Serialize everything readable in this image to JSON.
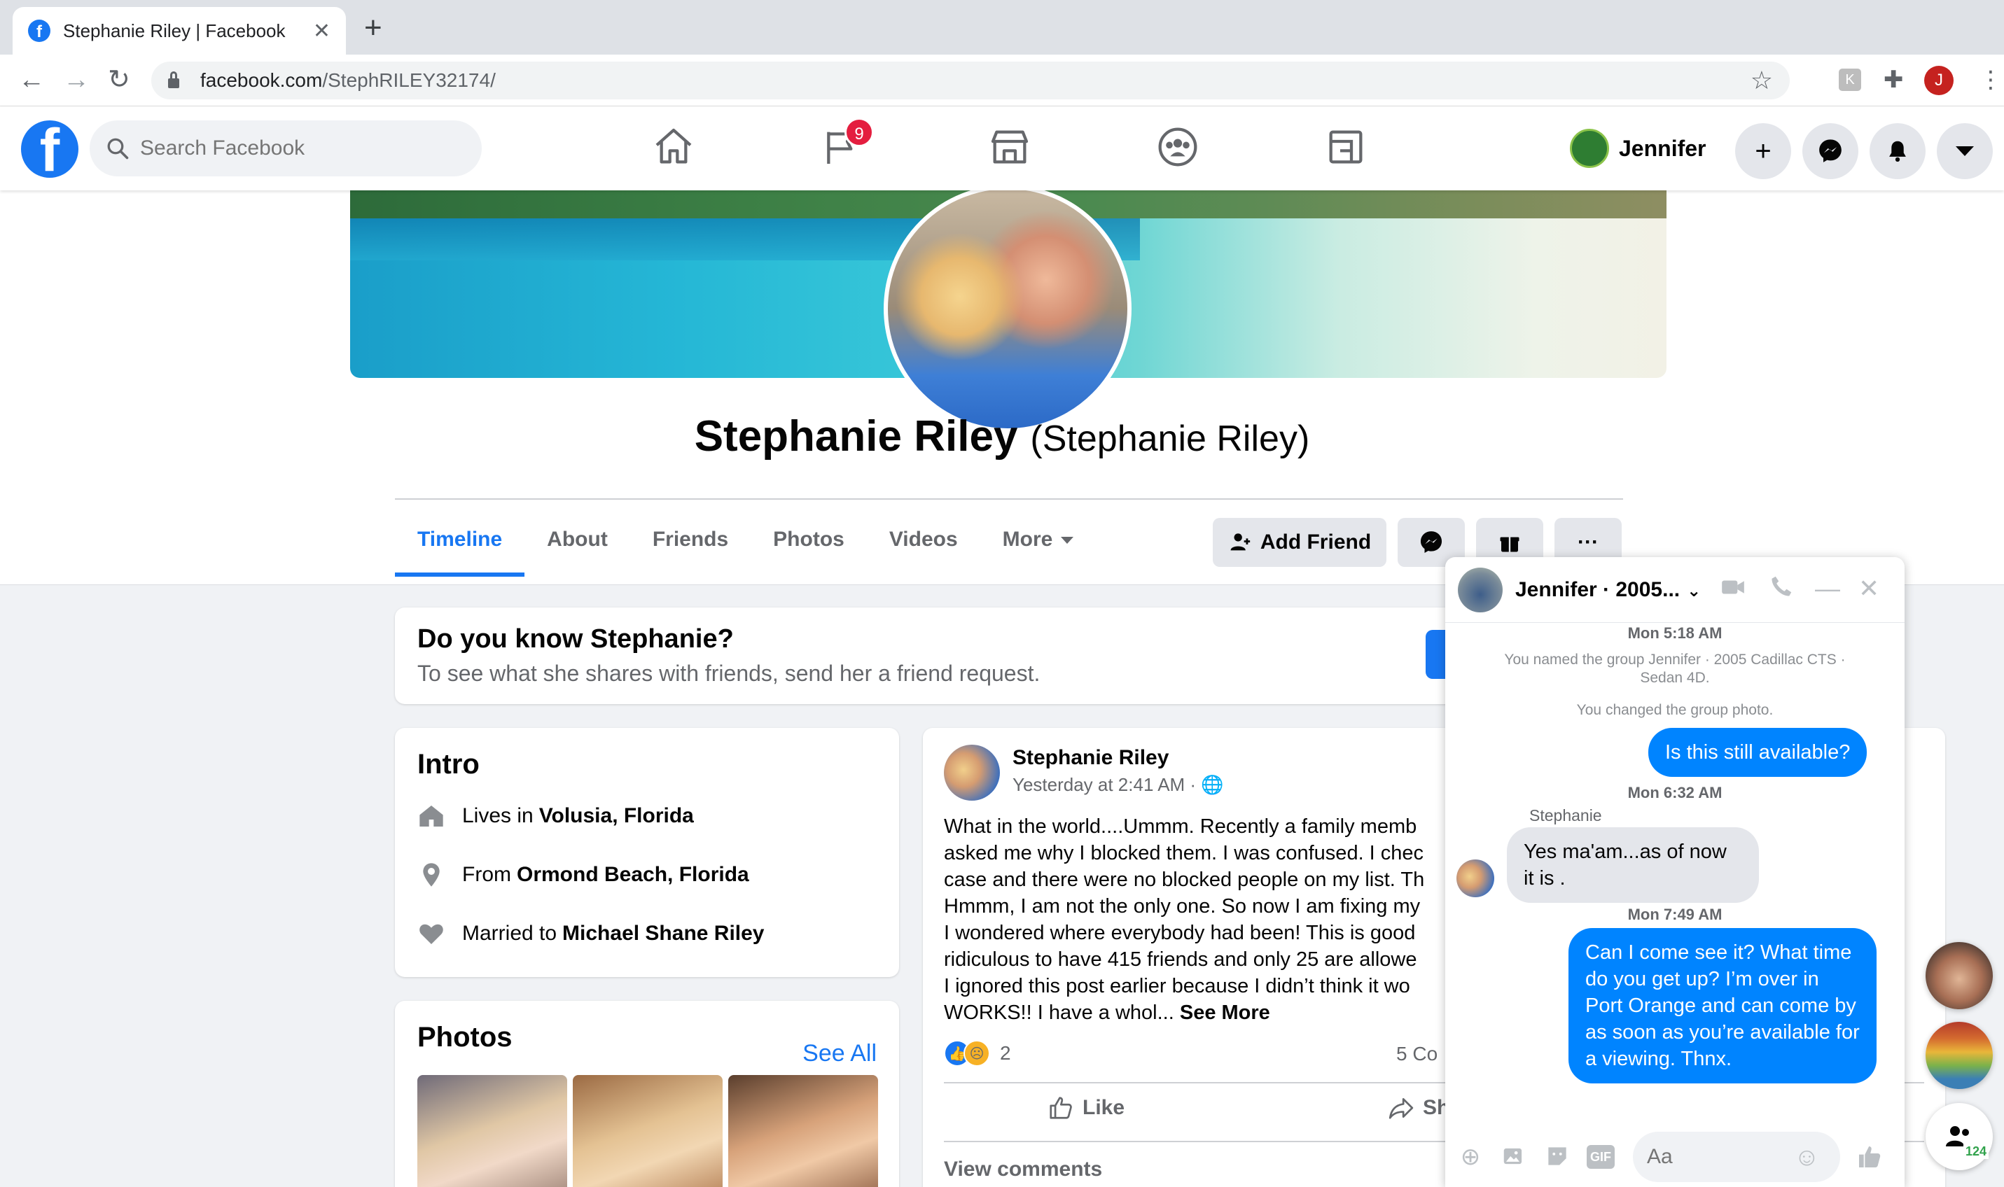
{
  "browser": {
    "tab_title": "Stephanie Riley | Facebook",
    "url_domain": "facebook.com",
    "url_path": "/StephRILEY32174/",
    "profile_initial": "J"
  },
  "fb": {
    "search_placeholder": "Search Facebook",
    "pages_badge": "9",
    "user_name": "Jennifer"
  },
  "profile": {
    "name": "Stephanie Riley",
    "alt_name": "(Stephanie Riley)",
    "tabs": [
      "Timeline",
      "About",
      "Friends",
      "Photos",
      "Videos",
      "More"
    ],
    "active_tab": "Timeline",
    "add_friend_label": "Add Friend"
  },
  "know": {
    "title": "Do you know Stephanie?",
    "subtitle": "To see what she shares with friends, send her a friend request."
  },
  "intro": {
    "title": "Intro",
    "lives_prefix": "Lives in",
    "lives": "Volusia, Florida",
    "from_prefix": "From",
    "from": "Ormond Beach, Florida",
    "married_prefix": "Married to",
    "married": "Michael Shane Riley"
  },
  "photos": {
    "title": "Photos",
    "see_all": "See All"
  },
  "post": {
    "author": "Stephanie Riley",
    "time": "Yesterday at 2:41 AM ·",
    "text": "What in the world....Ummm. Recently a family memb\nasked me why I blocked them. I was confused. I chec\ncase and there were no blocked people on my list. Th\nHmmm, I am not the only one. So now I am fixing my\nI wondered where everybody had been! This is good\nridiculous to have 415 friends and only 25 are allowe\nI ignored this post earlier because I didn’t think it wo\nWORKS!! I have a whol...",
    "see_more": "See More",
    "reaction_count": "2",
    "comments_count": "5 Co",
    "like_label": "Like",
    "share_label": "Sh",
    "view_comments": "View comments"
  },
  "chat": {
    "title": "Jennifer · 2005...",
    "ts1": "Mon 5:18 AM",
    "sys1": "You named the group Jennifer · 2005 Cadillac CTS · Sedan 4D.",
    "sys2": "You changed the group photo.",
    "msg1": "Is this still available?",
    "ts2": "Mon 6:32 AM",
    "sender": "Stephanie",
    "msg2": "Yes ma'am...as of now it is .",
    "ts3": "Mon 7:49 AM",
    "msg3": "Can I come see it? What time do you get up? I’m over in Port Orange and can come by as soon as you’re available for a viewing. Thnx.",
    "input_placeholder": "Aa",
    "gif_label": "GIF"
  },
  "contacts": {
    "count_badge": "124"
  },
  "colors": {
    "fb_blue": "#1877f2",
    "messenger_blue": "#0084ff",
    "badge_red": "#e41e3f"
  }
}
